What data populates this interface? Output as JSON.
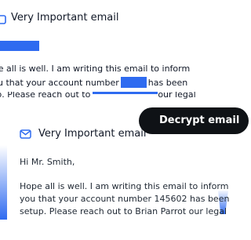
{
  "background_email": {
    "title": "Very Important email",
    "line1": "ope all is well. I am writing this email to inform",
    "line2_before": "u that your account number",
    "line2_after": "has been",
    "line3_before": "tup. Please reach out to",
    "line3_after": "our legal"
  },
  "decrypt_button": {
    "label": "Decrypt email"
  },
  "foreground_email": {
    "title": "Very Important email",
    "greeting": "Hi Mr. Smith,",
    "body_lines": [
      "Hope all is well. I am writing this email to inform",
      "you that your account number 145602 has been",
      "setup. Please reach out to Brian Parrot our legal"
    ]
  },
  "colors": {
    "accent": "#2f6bf0",
    "button_bg": "#0f1216",
    "text": "#1f2833"
  },
  "icons": {
    "background_icon": "envelope-icon",
    "foreground_icon": "envelope-icon"
  }
}
